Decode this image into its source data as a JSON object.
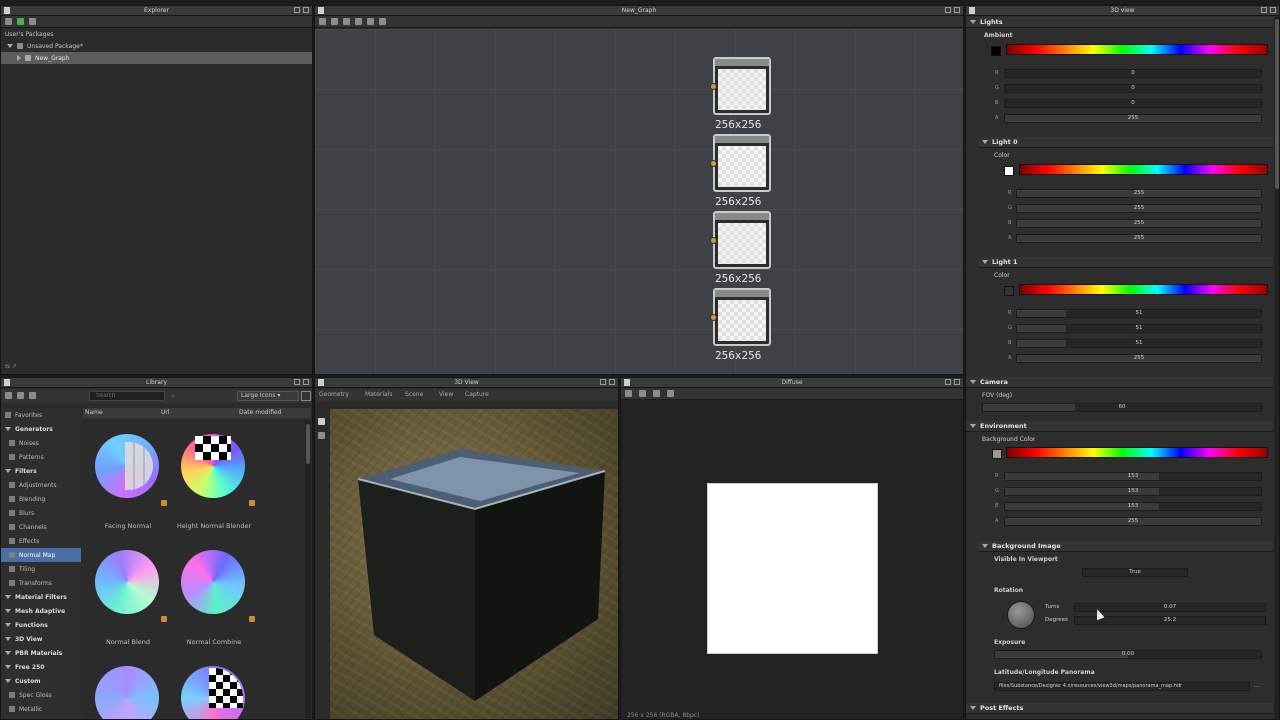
{
  "explorer": {
    "title": "Explorer",
    "root_label": "User's Packages",
    "package": "Unsaved Package*",
    "graph_item": "New_Graph"
  },
  "graph": {
    "title": "New_Graph",
    "nodes": [
      {
        "size": "256x256"
      },
      {
        "size": "256x256"
      },
      {
        "size": "256x256"
      },
      {
        "size": "256x256"
      }
    ]
  },
  "library": {
    "title": "Library",
    "search_placeholder": "Search",
    "view_mode": "Large Icons",
    "columns": [
      "Name",
      "Url",
      "Date modified"
    ],
    "categories": [
      {
        "label": "Favorites",
        "bold": false,
        "sel": false,
        "indent": 0
      },
      {
        "label": "Generators",
        "bold": true,
        "sel": false,
        "indent": 0
      },
      {
        "label": "Noises",
        "bold": false,
        "sel": false,
        "indent": 1
      },
      {
        "label": "Patterns",
        "bold": false,
        "sel": false,
        "indent": 1
      },
      {
        "label": "Filters",
        "bold": true,
        "sel": false,
        "indent": 0
      },
      {
        "label": "Adjustments",
        "bold": false,
        "sel": false,
        "indent": 1
      },
      {
        "label": "Blending",
        "bold": false,
        "sel": false,
        "indent": 1
      },
      {
        "label": "Blurs",
        "bold": false,
        "sel": false,
        "indent": 1
      },
      {
        "label": "Channels",
        "bold": false,
        "sel": false,
        "indent": 1
      },
      {
        "label": "Effects",
        "bold": false,
        "sel": false,
        "indent": 1
      },
      {
        "label": "Normal Map",
        "bold": false,
        "sel": true,
        "indent": 1
      },
      {
        "label": "Tiling",
        "bold": false,
        "sel": false,
        "indent": 1
      },
      {
        "label": "Transforms",
        "bold": false,
        "sel": false,
        "indent": 1
      },
      {
        "label": "Material Filters",
        "bold": true,
        "sel": false,
        "indent": 0
      },
      {
        "label": "Mesh Adaptive",
        "bold": true,
        "sel": false,
        "indent": 0
      },
      {
        "label": "Functions",
        "bold": true,
        "sel": false,
        "indent": 0
      },
      {
        "label": "3D View",
        "bold": true,
        "sel": false,
        "indent": 0
      },
      {
        "label": "PBR Materials",
        "bold": true,
        "sel": false,
        "indent": 0
      },
      {
        "label": "Free 250",
        "bold": true,
        "sel": false,
        "indent": 0
      },
      {
        "label": "Custom",
        "bold": true,
        "sel": false,
        "indent": 0
      },
      {
        "label": "Spec Gloss",
        "bold": false,
        "sel": false,
        "indent": 1
      },
      {
        "label": "Metallic",
        "bold": false,
        "sel": false,
        "indent": 1
      }
    ],
    "items": [
      {
        "label": "Facing Normal"
      },
      {
        "label": "Height Normal Blender"
      },
      {
        "label": "Normal Blend"
      },
      {
        "label": "Normal Combine"
      },
      {
        "label": ""
      },
      {
        "label": ""
      }
    ]
  },
  "view3d": {
    "title": "3D View",
    "menu": [
      "Geometry",
      "Materials",
      "Scene",
      "View",
      "Capture"
    ]
  },
  "diffuse": {
    "title": "Diffuse",
    "status": "256 x 256 (RGBA, 8bpc)"
  },
  "props": {
    "title": "3D view",
    "lights_header": "Lights",
    "ambient_label": "Ambient",
    "ambient": {
      "r": "0",
      "g": "0",
      "b": "0",
      "a": "255",
      "swatch": "#000000"
    },
    "light0_header": "Light 0",
    "light0_color_label": "Color",
    "light0": {
      "r": "255",
      "g": "255",
      "b": "255",
      "a": "255",
      "swatch": "#ffffff"
    },
    "light1_header": "Light 1",
    "light1_color_label": "Color",
    "light1": {
      "r": "51",
      "g": "51",
      "b": "51",
      "a": "255",
      "swatch": "#333333"
    },
    "camera_header": "Camera",
    "fov_label": "FOV (deg)",
    "fov_value": "60",
    "environment_header": "Environment",
    "bg_color_label": "Background Color",
    "bg": {
      "r": "153",
      "g": "153",
      "b": "153",
      "a": "255",
      "swatch": "#999999"
    },
    "bg_image_header": "Background Image",
    "visible_label": "Visible In Viewport",
    "visible_value": "True",
    "rotation_label": "Rotation",
    "turns_label": "Turns",
    "turns_value": "0.07",
    "degrees_label": "Degrees",
    "degrees_value": "25.2",
    "exposure_label": "Exposure",
    "exposure_value": "0.00",
    "panorama_label": "Latitude/Longitude Panorama",
    "panorama_value": "files/Substance/Designer 4.x/resources/view3d/maps/panorama_map.hdr",
    "post_effects_header": "Post Effects",
    "channel_labels": {
      "r": "R",
      "g": "G",
      "b": "B",
      "a": "A"
    }
  }
}
